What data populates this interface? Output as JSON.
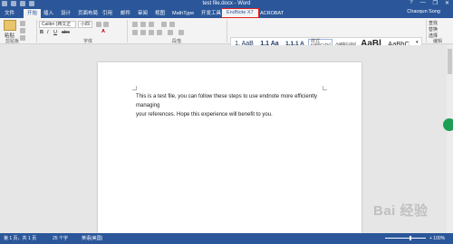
{
  "window": {
    "title": "test file.docx - Word",
    "controls": [
      "?",
      "—",
      "❐",
      "✕"
    ]
  },
  "ribbon_tabs": [
    "文件",
    "开始",
    "插入",
    "设计",
    "页面布局",
    "引用",
    "邮件",
    "审阅",
    "视图",
    "MathType",
    "开发工具",
    "EndNote X7",
    "ACROBAT"
  ],
  "user": "Chaoqun Song",
  "home": {
    "clipboard": {
      "paste_label": "粘贴",
      "group_label": "剪贴板"
    },
    "font": {
      "name": "Calibri (西文正",
      "size": "小四",
      "group_label": "字体",
      "buttons": [
        "B",
        "I",
        "U",
        "abc",
        "A"
      ]
    },
    "paragraph": {
      "group_label": "段落"
    },
    "styles": {
      "group_label": "样式",
      "items": [
        {
          "preview": "1. AaB",
          "name": "1 1st Title"
        },
        {
          "preview": "1.1 Aa",
          "name": "2 2nd title"
        },
        {
          "preview": "1.1.1 A",
          "name": "3 3rd title"
        },
        {
          "preview": "AaBbCcDd",
          "name": "正文"
        },
        {
          "preview": "AaBbCcDd",
          "name": "无间隔"
        },
        {
          "preview": "AaBl",
          "name": "标题 1"
        },
        {
          "preview": "AaBbC",
          "name": "标题 2"
        }
      ]
    },
    "editing": {
      "find": "查找",
      "replace": "替换",
      "select": "选择",
      "group_label": "编辑"
    }
  },
  "document": {
    "line1": "This is a test file, you can follow these steps to use endnote more efficiently managing",
    "line2": "your references. Hope this experience will benefit to you."
  },
  "status_bar": {
    "page": "第 1 页，共 1 页",
    "words": "25 个字",
    "language": "英语(美国)",
    "zoom": "+ 100%"
  },
  "watermark": "Bai 经验",
  "colors": {
    "accent": "#2b579a",
    "highlight_border": "#e02020",
    "float_button": "#1e9e55"
  }
}
